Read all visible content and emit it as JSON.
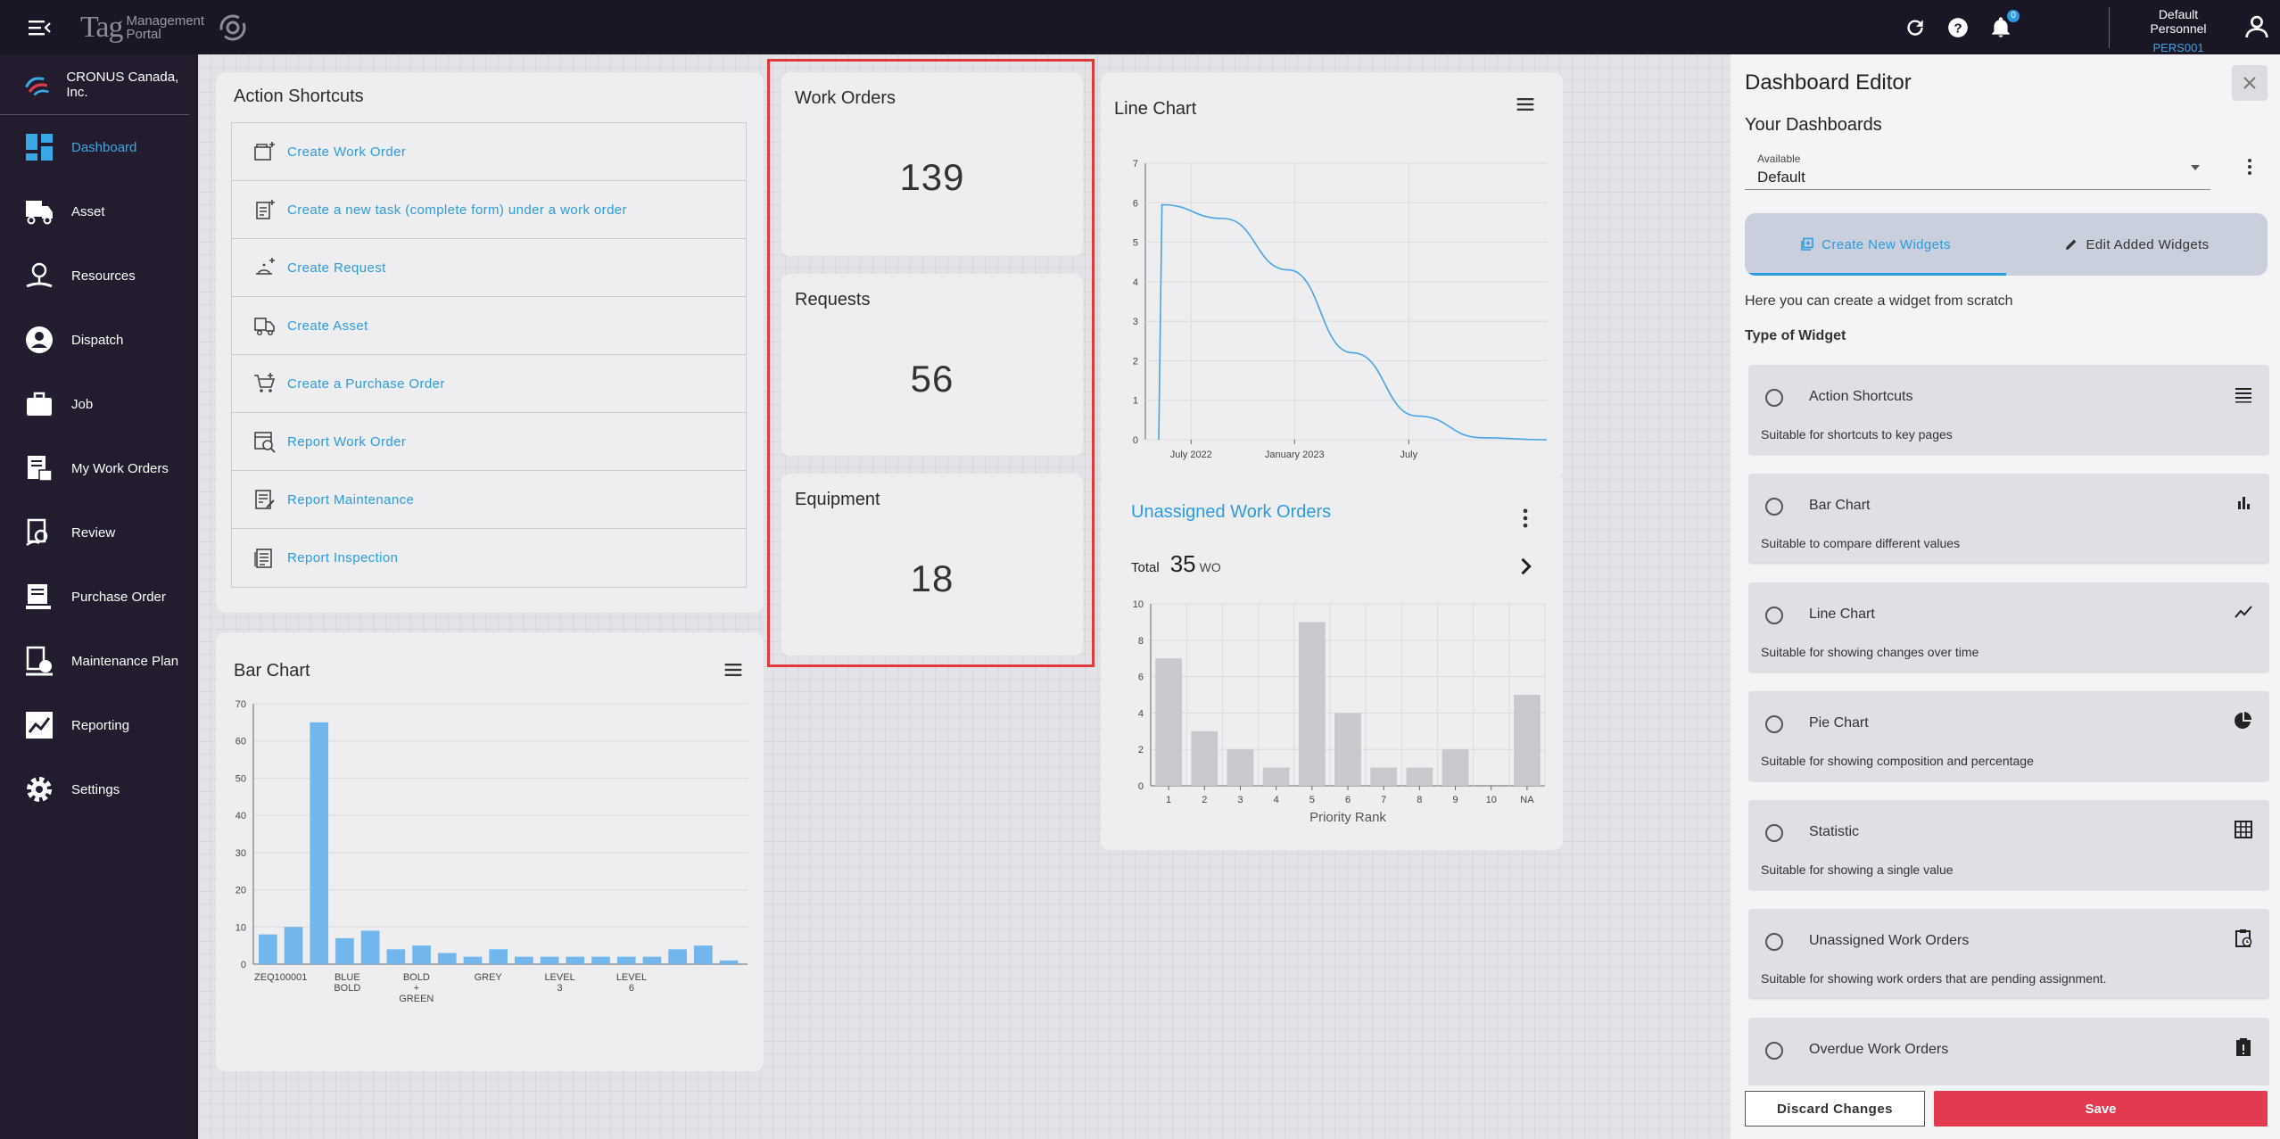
{
  "topbar": {
    "logo_text": "Tag",
    "logo_sub_1": "Management",
    "logo_sub_2": "Portal",
    "notification_count": "0",
    "user_name": "Default Personnel",
    "user_code": "PERS001"
  },
  "sidebar": {
    "company": "CRONUS Canada, Inc.",
    "items": [
      {
        "label": "Dashboard",
        "icon": "dashboard-icon"
      },
      {
        "label": "Asset",
        "icon": "truck-icon"
      },
      {
        "label": "Resources",
        "icon": "resources-icon"
      },
      {
        "label": "Dispatch",
        "icon": "dispatch-icon"
      },
      {
        "label": "Job",
        "icon": "briefcase-icon"
      },
      {
        "label": "My Work Orders",
        "icon": "work-orders-icon"
      },
      {
        "label": "Review",
        "icon": "review-icon"
      },
      {
        "label": "Purchase Order",
        "icon": "purchase-order-icon"
      },
      {
        "label": "Maintenance Plan",
        "icon": "maintenance-plan-icon"
      },
      {
        "label": "Reporting",
        "icon": "reporting-icon"
      },
      {
        "label": "Settings",
        "icon": "gear-icon"
      }
    ]
  },
  "shortcuts": {
    "title": "Action Shortcuts",
    "items": [
      "Create Work Order",
      "Create a new task (complete form) under a work order",
      "Create Request",
      "Create Asset",
      "Create a Purchase Order",
      "Report Work Order",
      "Report Maintenance",
      "Report Inspection"
    ]
  },
  "stats": {
    "work_orders": {
      "title": "Work Orders",
      "value": "139"
    },
    "requests": {
      "title": "Requests",
      "value": "56"
    },
    "equipment": {
      "title": "Equipment",
      "value": "18"
    }
  },
  "unassigned": {
    "title": "Unassigned Work Orders",
    "total_label": "Total",
    "total_value": "35",
    "total_unit": "WO"
  },
  "chart_data": [
    {
      "type": "line",
      "title": "Line Chart",
      "x_tick_labels": [
        "July 2022",
        "January 2023",
        "July"
      ],
      "ylim": [
        0,
        7
      ],
      "y_ticks": [
        0,
        1,
        2,
        3,
        4,
        5,
        6,
        7
      ],
      "series": [
        {
          "x_month_index": [
            0,
            0.15,
            3,
            6,
            9,
            12,
            15,
            18
          ],
          "values": [
            0,
            5.95,
            5.6,
            4.3,
            2.2,
            0.6,
            0.05,
            0
          ]
        }
      ],
      "color": "#4aa3e6"
    },
    {
      "type": "bar",
      "title": "Bar Chart",
      "ylim": [
        0,
        70
      ],
      "y_ticks": [
        0,
        10,
        20,
        30,
        40,
        50,
        60,
        70
      ],
      "categories": [
        "ZEQ100001",
        "",
        "",
        "BLUE BOLD",
        "",
        "BOLD + GREEN",
        "",
        "",
        "",
        "GREY",
        "",
        "",
        "",
        "LEVEL 3",
        "",
        "",
        "LEVEL 6",
        "",
        "",
        ""
      ],
      "tick_labels": [
        "ZEQ100001",
        "BLUE\nBOLD",
        "BOLD\n+\nGREEN",
        "GREY",
        "LEVEL\n3",
        "LEVEL\n6"
      ],
      "values": [
        8,
        10,
        65,
        7,
        9,
        4,
        5,
        3,
        2,
        4,
        2,
        2,
        2,
        2,
        2,
        2,
        4,
        5,
        1
      ],
      "color": "#71b6ec"
    },
    {
      "type": "bar",
      "title": "Unassigned Work Orders",
      "xlabel": "Priority Rank",
      "ylim": [
        0,
        10
      ],
      "y_ticks": [
        0,
        2,
        4,
        6,
        8,
        10
      ],
      "categories": [
        "1",
        "2",
        "3",
        "4",
        "5",
        "6",
        "7",
        "8",
        "9",
        "10",
        "NA"
      ],
      "values": [
        7,
        3,
        2,
        1,
        9,
        4,
        1,
        1,
        2,
        0,
        5
      ],
      "color": "#c8c8cd"
    }
  ],
  "editor": {
    "title": "Dashboard Editor",
    "your_dashboards": "Your Dashboards",
    "select_label": "Available",
    "select_value": "Default",
    "tab_create": "Create New Widgets",
    "tab_edit": "Edit Added Widgets",
    "help_text": "Here you can create a widget from scratch",
    "type_label": "Type of Widget",
    "widgets": [
      {
        "name": "Action Shortcuts",
        "desc": "Suitable for shortcuts to key pages",
        "icon": "list-icon"
      },
      {
        "name": "Bar Chart",
        "desc": "Suitable to compare different values",
        "icon": "bar-chart-icon"
      },
      {
        "name": "Line Chart",
        "desc": "Suitable for showing changes over time",
        "icon": "line-chart-icon"
      },
      {
        "name": "Pie Chart",
        "desc": "Suitable for showing composition and percentage",
        "icon": "pie-chart-icon"
      },
      {
        "name": "Statistic",
        "desc": "Suitable for showing a single value",
        "icon": "grid-icon"
      },
      {
        "name": "Unassigned Work Orders",
        "desc": "Suitable for showing work orders that are pending assignment.",
        "icon": "clipboard-clock-icon"
      },
      {
        "name": "Overdue Work Orders",
        "desc": "",
        "icon": "alert-clipboard-icon"
      }
    ],
    "discard_label": "Discard Changes",
    "save_label": "Save"
  }
}
